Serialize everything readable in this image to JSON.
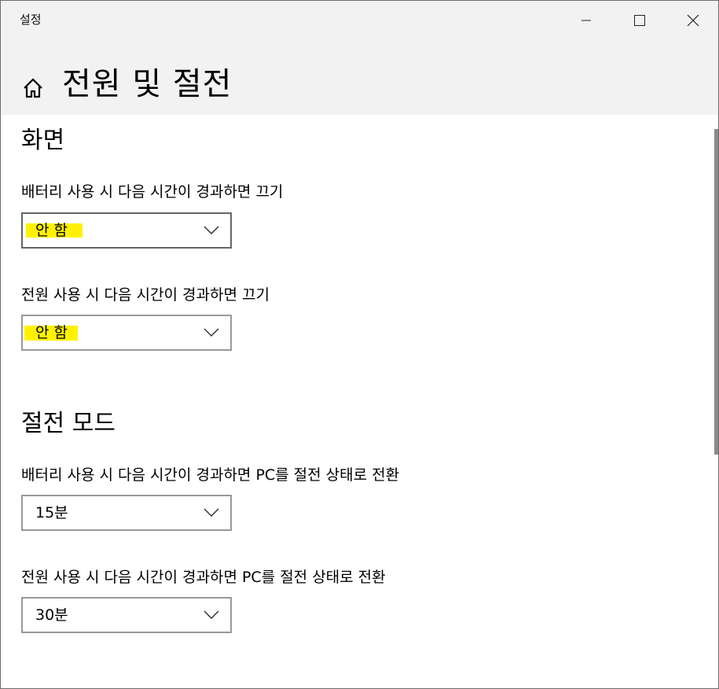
{
  "window": {
    "title": "설정",
    "controls": [
      "minimize-icon",
      "maximize-icon",
      "close-icon"
    ]
  },
  "header": {
    "home_icon": "home-icon",
    "title": "전원 및 절전"
  },
  "screen_section": {
    "title": "화면",
    "battery_label": "배터리 사용 시 다음 시간이 경과하면 끄기",
    "battery_value": "안 함",
    "power_label": "전원 사용 시 다음 시간이 경과하면 끄기",
    "power_value": "안 함"
  },
  "sleep_section": {
    "title": "절전 모드",
    "battery_label": "배터리 사용 시 다음 시간이 경과하면 PC를 절전 상태로 전환",
    "battery_value": "15분",
    "power_label": "전원 사용 시 다음 시간이 경과하면 PC를 절전 상태로 전환",
    "power_value": "30분"
  },
  "colors": {
    "highlight": "#fff200",
    "header_bg": "#f2f2f2",
    "dropdown_border": "#999999"
  }
}
